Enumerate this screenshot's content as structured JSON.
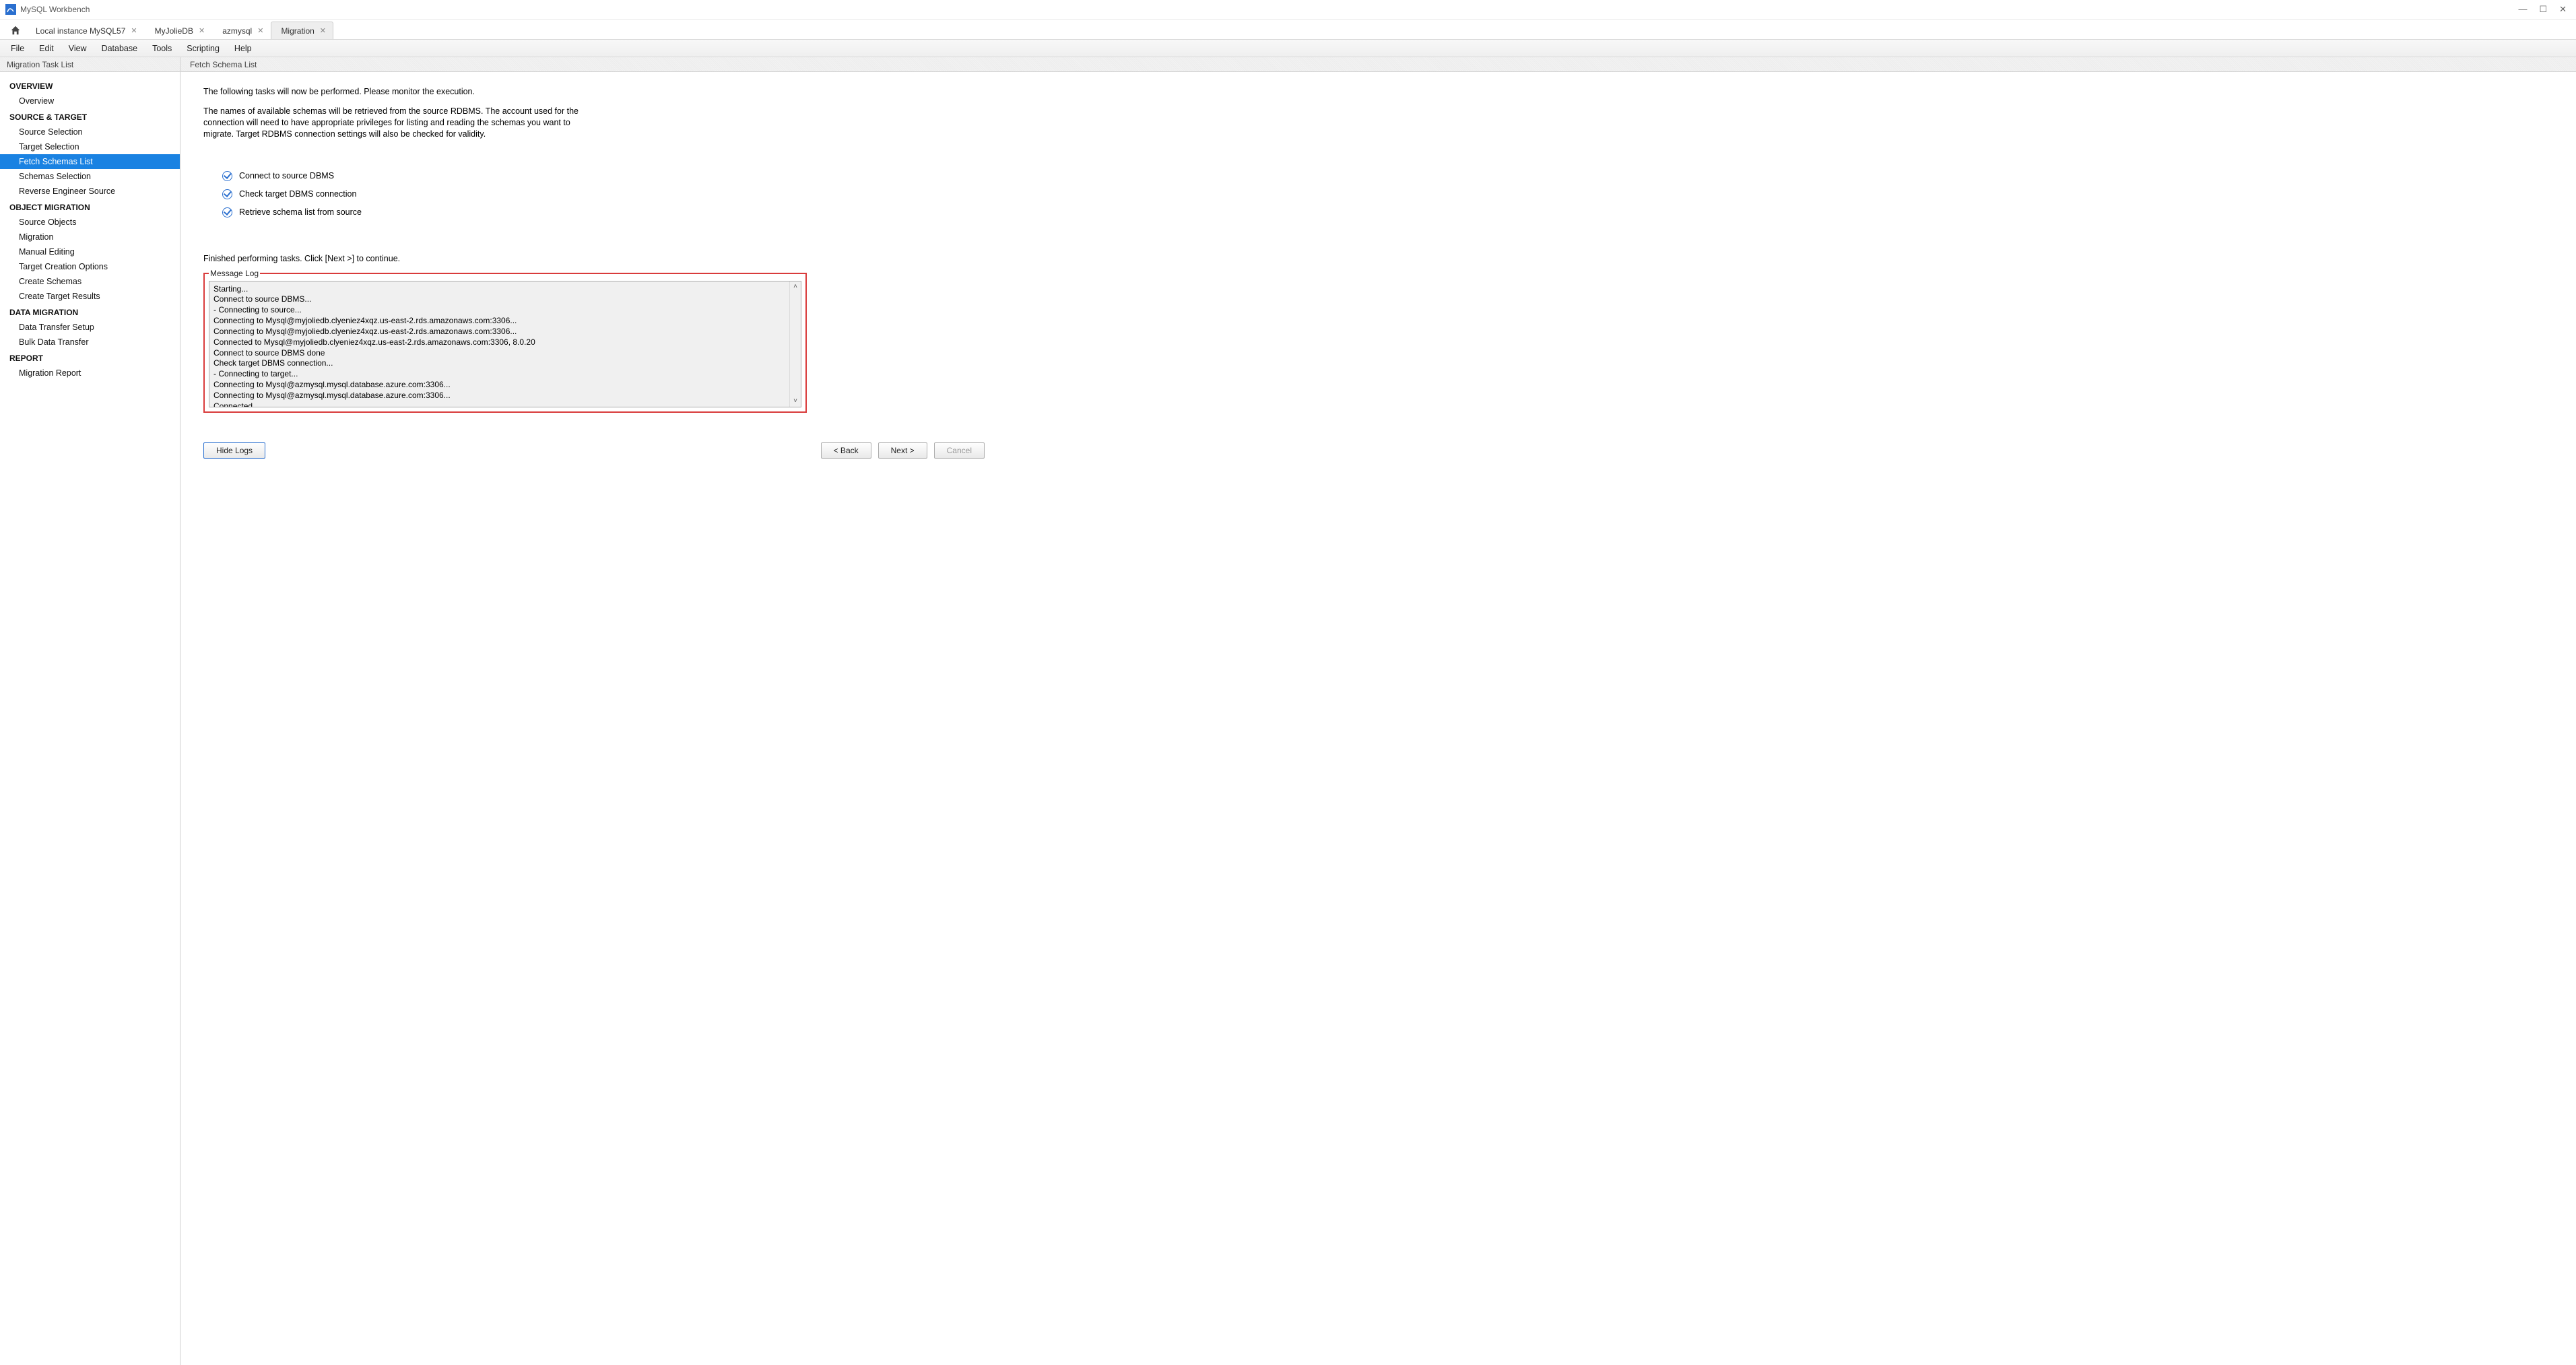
{
  "window": {
    "title": "MySQL Workbench"
  },
  "tabs": {
    "items": [
      {
        "label": "Local instance MySQL57"
      },
      {
        "label": "MyJolieDB"
      },
      {
        "label": "azmysql"
      },
      {
        "label": "Migration"
      }
    ]
  },
  "menu": {
    "items": [
      "File",
      "Edit",
      "View",
      "Database",
      "Tools",
      "Scripting",
      "Help"
    ]
  },
  "headers": {
    "left": "Migration Task List",
    "right": "Fetch Schema List"
  },
  "sidebar": {
    "sections": [
      {
        "heading": "OVERVIEW",
        "items": [
          "Overview"
        ]
      },
      {
        "heading": "SOURCE & TARGET",
        "items": [
          "Source Selection",
          "Target Selection",
          "Fetch Schemas List",
          "Schemas Selection",
          "Reverse Engineer Source"
        ]
      },
      {
        "heading": "OBJECT MIGRATION",
        "items": [
          "Source Objects",
          "Migration",
          "Manual Editing",
          "Target Creation Options",
          "Create Schemas",
          "Create Target Results"
        ]
      },
      {
        "heading": "DATA MIGRATION",
        "items": [
          "Data Transfer Setup",
          "Bulk Data Transfer"
        ]
      },
      {
        "heading": "REPORT",
        "items": [
          "Migration Report"
        ]
      }
    ],
    "active": "Fetch Schemas List"
  },
  "main": {
    "intro1": "The following tasks will now be performed. Please monitor the execution.",
    "intro2": "The names of available schemas will be retrieved from the source RDBMS. The account used for the connection will need to have appropriate privileges for listing and reading the schemas you want to migrate. Target RDBMS connection settings will also be checked for validity.",
    "tasks": [
      "Connect to source DBMS",
      "Check target DBMS connection",
      "Retrieve schema list from source"
    ],
    "finished": "Finished performing tasks. Click [Next >] to continue.",
    "log_legend": "Message Log",
    "log_lines": [
      "Starting...",
      "Connect to source DBMS...",
      "- Connecting to source...",
      "Connecting to Mysql@myjoliedb.clyeniez4xqz.us-east-2.rds.amazonaws.com:3306...",
      "Connecting to Mysql@myjoliedb.clyeniez4xqz.us-east-2.rds.amazonaws.com:3306...",
      "Connected to Mysql@myjoliedb.clyeniez4xqz.us-east-2.rds.amazonaws.com:3306, 8.0.20",
      "Connect to source DBMS done",
      "Check target DBMS connection...",
      "- Connecting to target...",
      "Connecting to Mysql@azmysql.mysql.database.azure.com:3306...",
      "Connecting to Mysql@azmysql.mysql.database.azure.com:3306...",
      "Connected"
    ]
  },
  "buttons": {
    "hide_logs": "Hide Logs",
    "back": "< Back",
    "next": "Next >",
    "cancel": "Cancel"
  }
}
